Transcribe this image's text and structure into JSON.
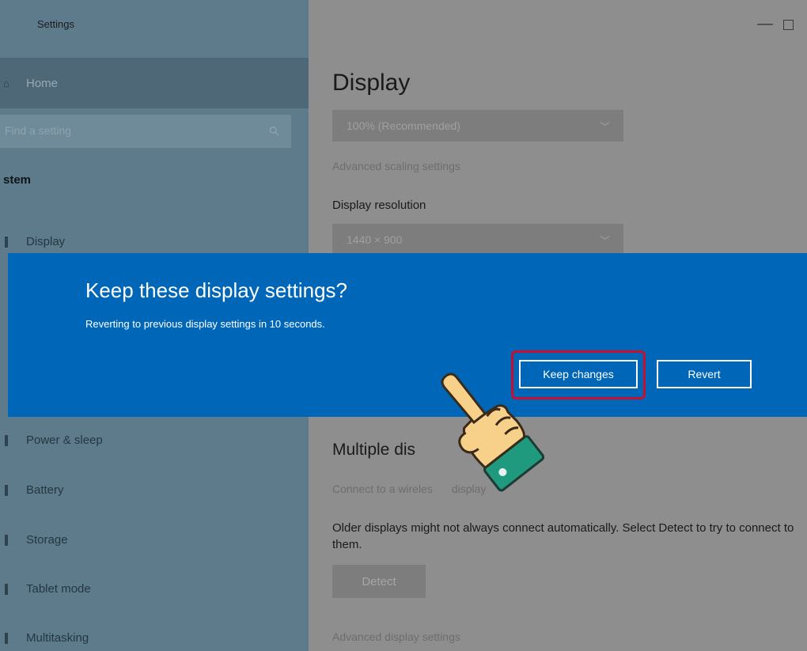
{
  "window": {
    "title": "Settings",
    "minimize_glyph": "—",
    "maximize_glyph": ""
  },
  "sidebar": {
    "home_label": "Home",
    "search_placeholder": "Find a setting",
    "section_label": "stem",
    "items": [
      {
        "label": "Display",
        "icon": "display-icon"
      },
      {
        "label": "Power & sleep",
        "icon": "power-icon"
      },
      {
        "label": "Battery",
        "icon": "battery-icon"
      },
      {
        "label": "Storage",
        "icon": "storage-icon"
      },
      {
        "label": "Tablet mode",
        "icon": "tablet-icon"
      },
      {
        "label": "Multitasking",
        "icon": "multitasking-icon"
      }
    ]
  },
  "main": {
    "title": "Display",
    "scale_value": "100% (Recommended)",
    "advanced_scaling_link": "Advanced scaling settings",
    "resolution_label": "Display resolution",
    "resolution_value": "1440 × 900",
    "multiple_displays_title": "Multiple dis",
    "wireless_link": "Connect to a wireles",
    "wireless_link_tail": "display",
    "older_displays_text": "Older displays might not always connect automatically. Select Detect to try to connect to them.",
    "detect_label": "Detect",
    "advanced_display_link": "Advanced display settings"
  },
  "dialog": {
    "title": "Keep these display settings?",
    "subtitle": "Reverting to previous display settings in 10 seconds.",
    "keep_label": "Keep changes",
    "revert_label": "Revert"
  },
  "colors": {
    "dialog_bg": "#0067b8",
    "highlight": "#c8102e",
    "sidebar_bg": "#5e7b8c",
    "main_bg": "#8e8e8e"
  },
  "annotation": {
    "icon": "pointing-hand-icon"
  }
}
